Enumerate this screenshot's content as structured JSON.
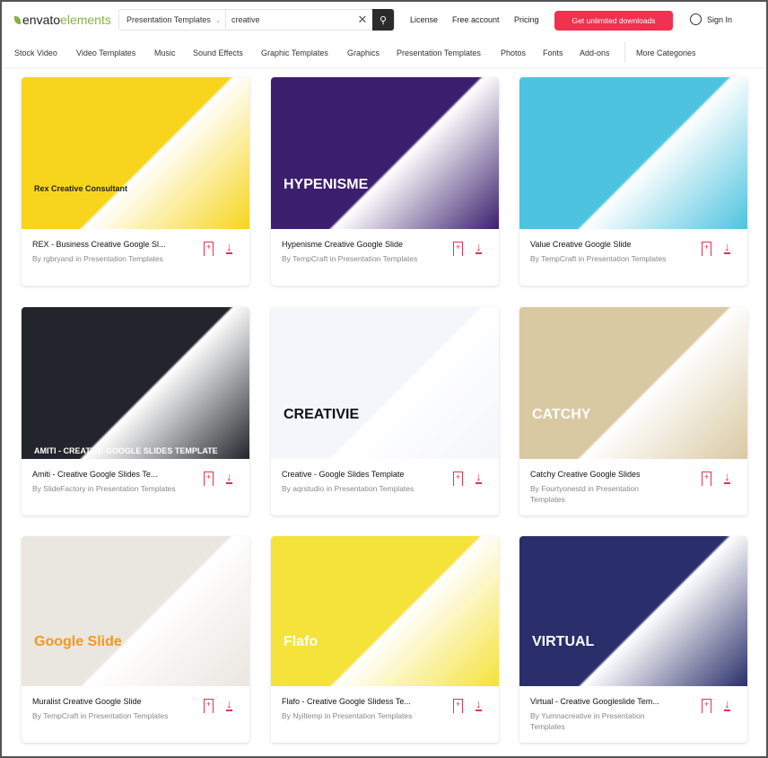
{
  "header": {
    "logo_brand": "envato",
    "logo_suffix": "elements",
    "search_category": "Presentation Templates",
    "search_query": "creative",
    "links": [
      "License",
      "Free account",
      "Pricing"
    ],
    "cta": "Get unlimited downloads",
    "sign_in": "Sign In"
  },
  "nav": [
    "Stock Video",
    "Video Templates",
    "Music",
    "Sound Effects",
    "Graphic Templates",
    "Graphics",
    "Presentation Templates",
    "Photos",
    "Fonts",
    "Add-ons",
    "More Categories"
  ],
  "accent": "#f0314f",
  "cards": [
    {
      "title": "REX - Business Creative Google Sl...",
      "byline": "By rgbryand in Presentation Templates",
      "thumb_text": "Rex Creative Consultant",
      "bg": "#f7d51d",
      "fg": "#222"
    },
    {
      "title": "Hypenisme Creative Google Slide",
      "byline": "By TempCraft in Presentation Templates",
      "thumb_text": "HYPENISME",
      "bg": "#3b1f6e",
      "fg": "#fff"
    },
    {
      "title": "Value Creative Google Slide",
      "byline": "By TempCraft in Presentation Templates",
      "thumb_text": "",
      "bg": "#4ec3e0",
      "fg": "#fff"
    },
    {
      "title": "Amiti - Creative Google Slides Te...",
      "byline": "By SlideFactory in Presentation Templates",
      "thumb_text": "AMITI - CREATIVE GOOGLE SLIDES TEMPLATE",
      "bg": "#22252b",
      "fg": "#fff"
    },
    {
      "title": "Creative - Google Slides Template",
      "byline": "By aqrstudio in Presentation Templates",
      "thumb_text": "CREATIVIE",
      "bg": "#f4f6fb",
      "fg": "#111"
    },
    {
      "title": "Catchy Creative Google Slides",
      "byline": "By Fourtyonestd in Presentation Templates",
      "thumb_text": "CATCHY",
      "bg": "#d9c9a3",
      "fg": "#fff"
    },
    {
      "title": "Muralist Creative Google Slide",
      "byline": "By TempCraft in Presentation Templates",
      "thumb_text": "Google Slide",
      "bg": "#eae6e0",
      "fg": "#f29a1d"
    },
    {
      "title": "Flafo - Creative Google Slidess Te...",
      "byline": "By Nyiltemp in Presentation Templates",
      "thumb_text": "Flafo",
      "bg": "#f5e23a",
      "fg": "#fff"
    },
    {
      "title": "Virtual - Creative Googleslide Tem...",
      "byline": "By Yumnacreative in Presentation Templates",
      "thumb_text": "VIRTUAL",
      "bg": "#2a2f6b",
      "fg": "#fff"
    }
  ]
}
